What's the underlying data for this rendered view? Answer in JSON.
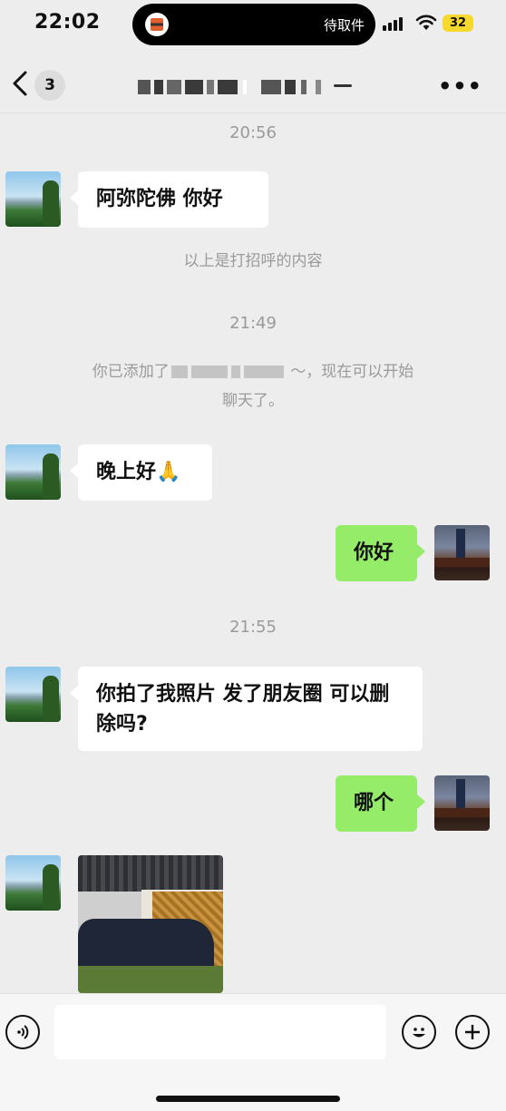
{
  "status_bar": {
    "time": "22:02",
    "island_text": "待取件",
    "battery": "32"
  },
  "nav": {
    "unread_count": "3"
  },
  "chat": {
    "ts1": "20:56",
    "msg1": "阿弥陀佛  你好",
    "sys1": "以上是打招呼的内容",
    "ts2": "21:49",
    "sys2_prefix": "你已添加了",
    "sys2_suffix": "～，现在可以开始",
    "sys2_line2": "聊天了。",
    "msg2": "晚上好🙏",
    "msg3": "你好",
    "ts3": "21:55",
    "msg4": "你拍了我照片  发了朋友圈  可以删除吗?",
    "msg5": "哪个"
  },
  "icons": {
    "back": "chevron-left-icon",
    "more": "more-dots-icon",
    "voice": "voice-icon",
    "emoji": "emoji-icon",
    "add": "plus-icon"
  },
  "colors": {
    "background": "#ededed",
    "sent_bubble": "#95ec69",
    "received_bubble": "#ffffff"
  }
}
